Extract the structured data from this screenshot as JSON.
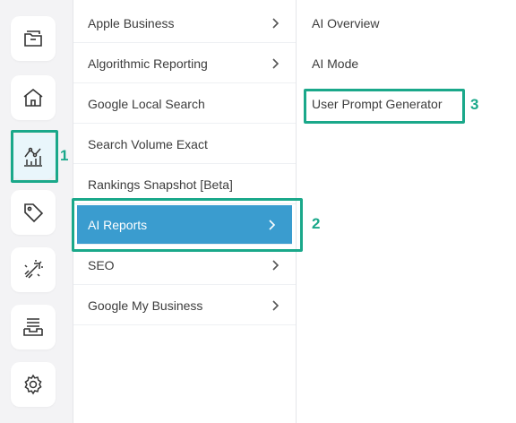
{
  "rail": {
    "items": [
      {
        "icon": "folder-icon",
        "active": false
      },
      {
        "icon": "home-icon",
        "active": false
      },
      {
        "icon": "analytics-icon",
        "active": true
      },
      {
        "icon": "tag-icon",
        "active": false
      },
      {
        "icon": "rocket-icon",
        "active": false
      },
      {
        "icon": "inbox-icon",
        "active": false
      },
      {
        "icon": "gear-icon",
        "active": false
      }
    ]
  },
  "menu1": {
    "items": [
      {
        "label": "Apple Business",
        "has_submenu": true
      },
      {
        "label": "Algorithmic Reporting",
        "has_submenu": true
      },
      {
        "label": "Google Local Search",
        "has_submenu": false
      },
      {
        "label": "Search Volume Exact",
        "has_submenu": false
      },
      {
        "label": "Rankings Snapshot [Beta]",
        "has_submenu": false
      },
      {
        "label": "AI Reports",
        "has_submenu": true,
        "active": true
      },
      {
        "label": "SEO",
        "has_submenu": true
      },
      {
        "label": "Google My Business",
        "has_submenu": true
      }
    ]
  },
  "menu2": {
    "items": [
      {
        "label": "AI Overview"
      },
      {
        "label": "AI Mode"
      },
      {
        "label": "User Prompt Generator"
      }
    ]
  },
  "annotations": {
    "step1": "1",
    "step2": "2",
    "step3": "3"
  },
  "colors": {
    "accent": "#3a9ccf",
    "highlight": "#1aa88a",
    "rail_bg": "#f3f3f5"
  }
}
